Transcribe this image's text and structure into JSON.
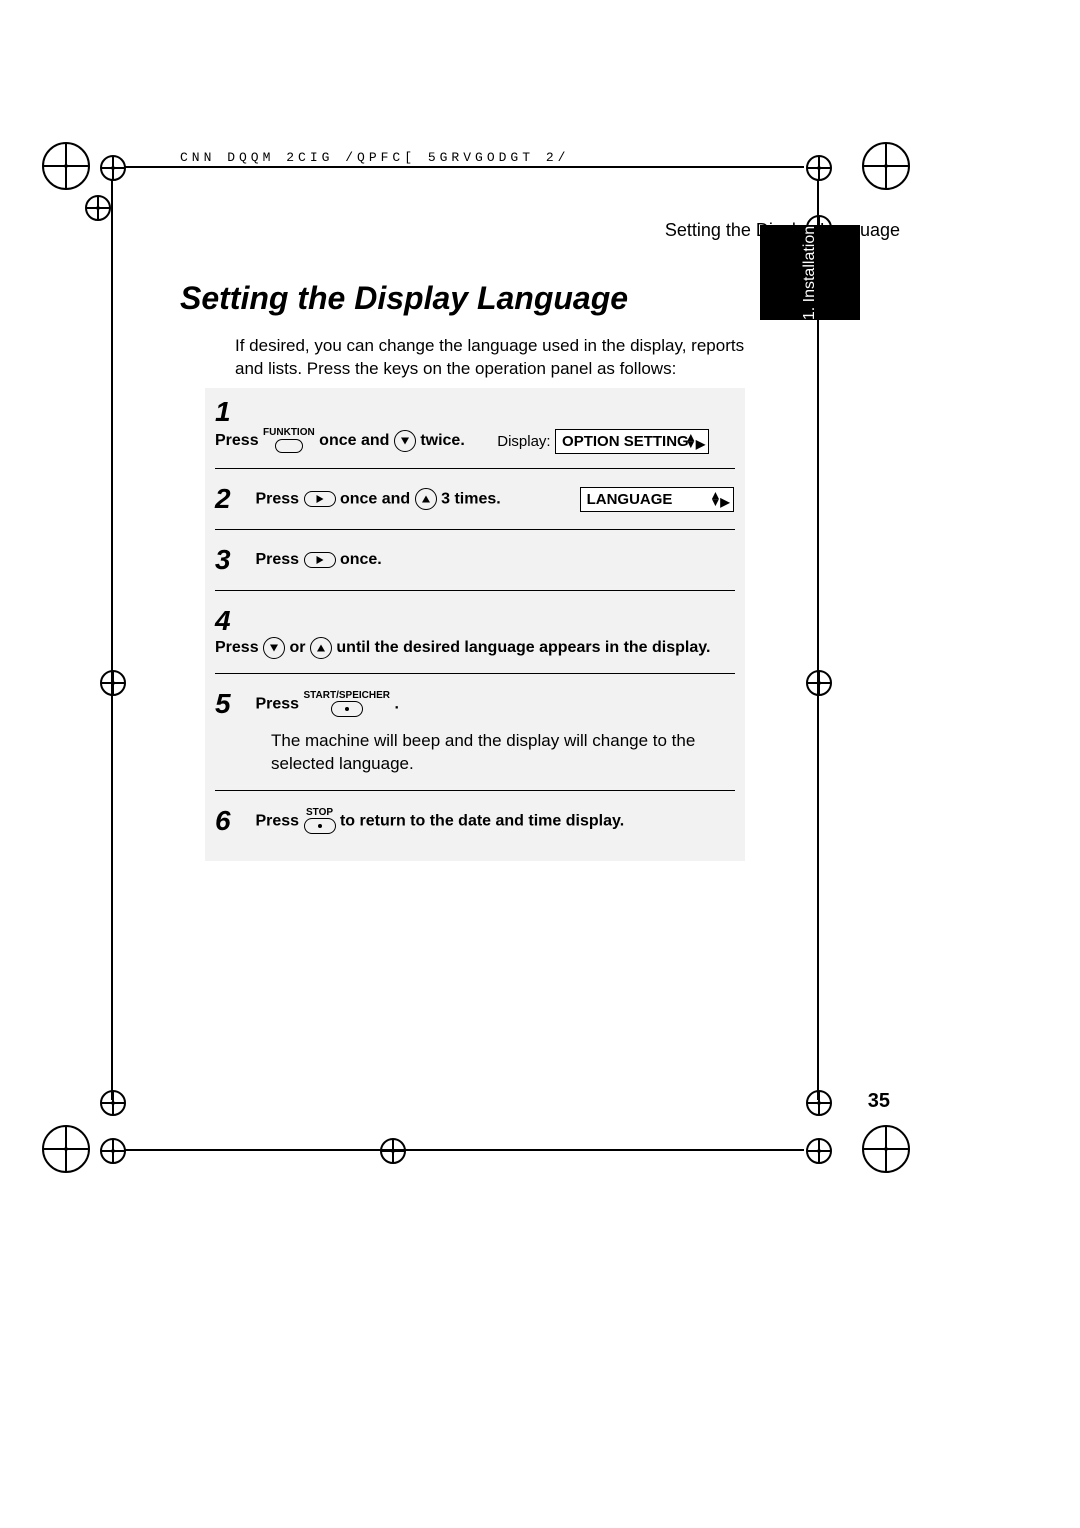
{
  "header_code": "CNN DQQM  2CIG   /QPFC[  5GRVGODGT           2/",
  "running_head": "Setting the Display Language",
  "side_tab": "1. Installation",
  "heading": "Setting the Display Language",
  "intro": "If desired, you can change the language used in the display, reports and lists. Press the keys on the operation panel as follows:",
  "steps": [
    {
      "num": "1",
      "parts": {
        "press": "Press",
        "key1_label": "FUNKTION",
        "mid1": "once and",
        "mid2": "twice."
      },
      "display_label": "Display:",
      "display_value": "OPTION SETTING"
    },
    {
      "num": "2",
      "parts": {
        "press": "Press",
        "mid1": "once and",
        "mid2": "3 times."
      },
      "display_value": "LANGUAGE"
    },
    {
      "num": "3",
      "parts": {
        "press": "Press",
        "mid1": "once."
      }
    },
    {
      "num": "4",
      "parts": {
        "press": "Press",
        "or": "or",
        "tail": "until the desired language appears in the display."
      }
    },
    {
      "num": "5",
      "parts": {
        "press": "Press",
        "key1_label": "START/SPEICHER",
        "tail": "."
      },
      "extra": "The machine will beep and the display will change to the selected language."
    },
    {
      "num": "6",
      "parts": {
        "press": "Press",
        "key1_label": "STOP",
        "tail": "to return to the date and time display."
      }
    }
  ],
  "page_number": "35"
}
